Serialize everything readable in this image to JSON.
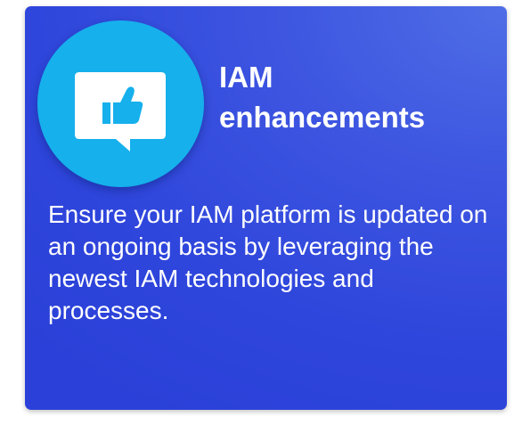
{
  "card": {
    "title_line1": "IAM",
    "title_line2": "enhancements",
    "description": "Ensure your IAM platform is updated on an ongoing basis by leveraging the newest IAM technologies and processes."
  },
  "icon": {
    "name": "thumbs-up-speech-bubble-icon",
    "badge_color": "#16b0ec",
    "bubble_color": "#ffffff",
    "symbol_color": "#16b0ec"
  },
  "colors": {
    "card_background": "#3048dc",
    "text": "#ffffff"
  }
}
